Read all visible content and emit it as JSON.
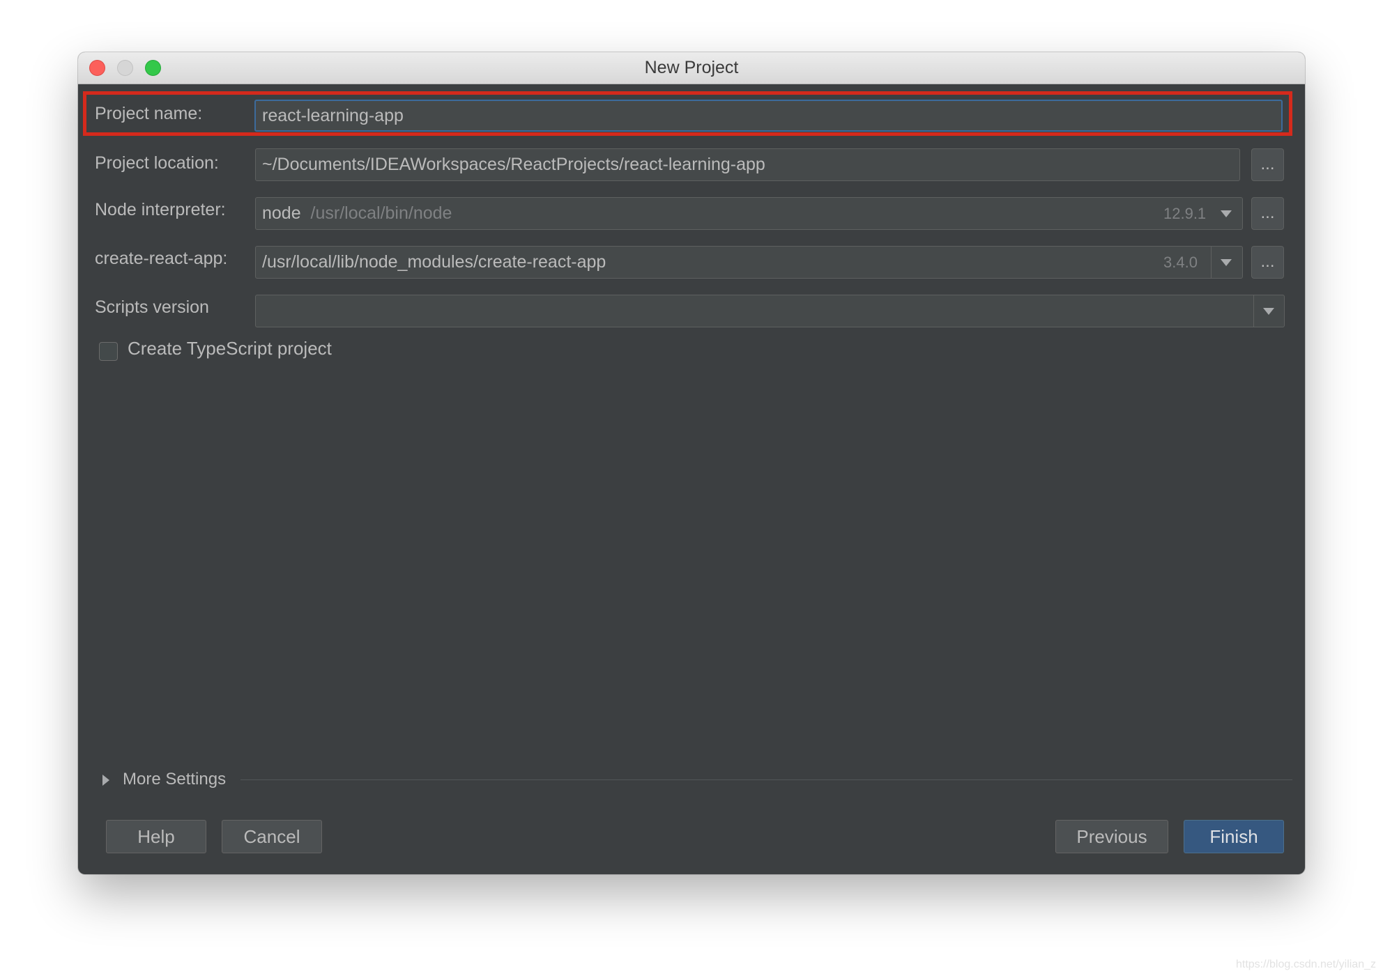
{
  "window": {
    "title": "New Project"
  },
  "form": {
    "project_name": {
      "label": "Project name:",
      "value": "react-learning-app"
    },
    "project_location": {
      "label": "Project location:",
      "value": "~/Documents/IDEAWorkspaces/ReactProjects/react-learning-app",
      "browse_label": "..."
    },
    "node_interpreter": {
      "label": "Node interpreter:",
      "name": "node",
      "path": "/usr/local/bin/node",
      "version": "12.9.1",
      "browse_label": "..."
    },
    "create_react_app": {
      "label": "create-react-app:",
      "value": "/usr/local/lib/node_modules/create-react-app",
      "version": "3.4.0",
      "browse_label": "..."
    },
    "scripts_version": {
      "label": "Scripts version",
      "value": ""
    },
    "typescript": {
      "label": "Create TypeScript project",
      "checked": false
    }
  },
  "more_settings": {
    "label": "More Settings",
    "expanded": false
  },
  "buttons": {
    "help": "Help",
    "cancel": "Cancel",
    "previous": "Previous",
    "finish": "Finish"
  },
  "watermark": "https://blog.csdn.net/yilian_z",
  "colors": {
    "dialog_bg": "#3c3f41",
    "field_bg": "#45494a",
    "highlight_border": "#d52a1c",
    "focus_border": "#3d6b9c",
    "primary_button": "#365880"
  }
}
